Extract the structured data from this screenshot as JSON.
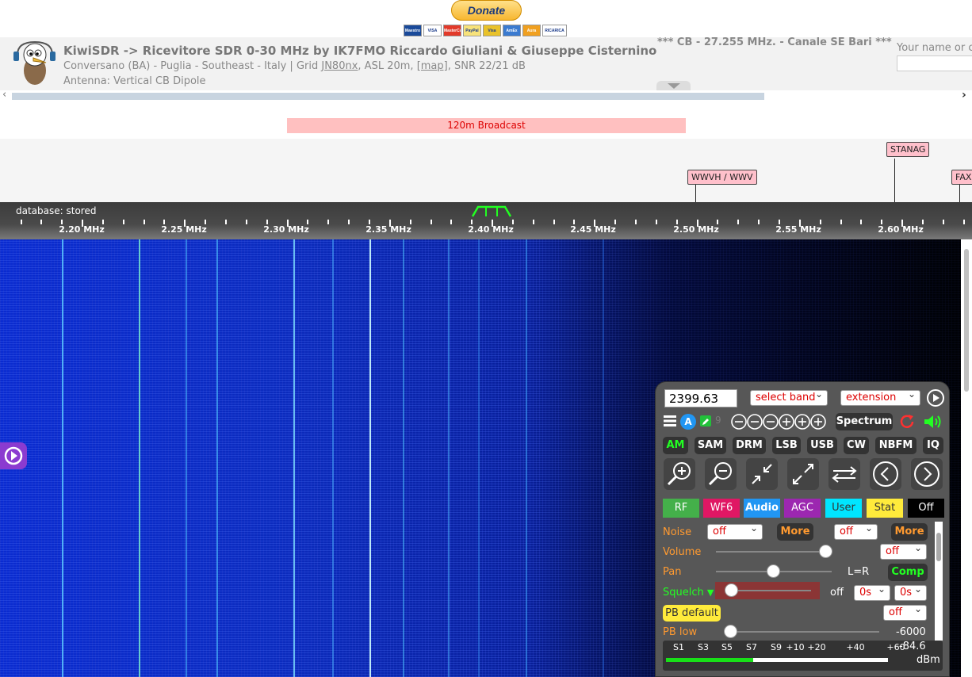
{
  "donate": {
    "label": "Donate",
    "cards": [
      "Maestro",
      "VISA",
      "MasterCard",
      "PayPal",
      "Visa Electron",
      "AmEx",
      "Aura",
      "RICARICA PAYPAL"
    ]
  },
  "header": {
    "title": "KiwiSDR -> Ricevitore SDR 0-30 MHz by IK7FMO Riccardo Giuliani & Giuseppe Cisternino",
    "location_prefix": "Conversano (BA) - Puglia - Southeast - Italy | Grid ",
    "grid": "JN80nx",
    "location_mid": ", ASL 20m, ",
    "map_link": "[map]",
    "location_suffix": ", SNR 22/21 dB",
    "antenna": "Antenna: Vertical CB Dipole",
    "motd": "*** CB - 27.255 MHz. - Canale SE Bari ***",
    "name_label": "Your name or c",
    "name_placeholder": ""
  },
  "scroll": {
    "left": "‹",
    "right": "›"
  },
  "band_bar": "120m Broadcast",
  "dx_labels": [
    "WWVH / WWV",
    "STANAG",
    "FAX"
  ],
  "scale": {
    "db_status": "database: stored",
    "freq_labels": [
      "2.20 MHz",
      "2.25 MHz",
      "2.30 MHz",
      "2.35 MHz",
      "2.40 MHz",
      "2.45 MHz",
      "2.50 MHz",
      "2.55 MHz",
      "2.60 MHz"
    ]
  },
  "panel": {
    "frequency": "2399.63",
    "select_band": "select band",
    "extension": "extension",
    "spectrum": "Spectrum",
    "badge_a": "A",
    "badge_9": "9",
    "modes": [
      "AM",
      "SAM",
      "DRM",
      "LSB",
      "USB",
      "CW",
      "NBFM",
      "IQ"
    ],
    "active_mode": "AM",
    "tabs": [
      "RF",
      "WF6",
      "Audio",
      "AGC",
      "User",
      "Stat",
      "Off"
    ],
    "noise_label": "Noise",
    "noise_a": "off",
    "noise_more_a": "More",
    "noise_b": "off",
    "noise_more_b": "More",
    "volume_label": "Volume",
    "volume_level": 0.95,
    "volume_sel": "off",
    "pan_label": "Pan",
    "pan_value": "L=R",
    "comp": "Comp",
    "squelch_label": "Squelch",
    "squelch_off": "off",
    "squelch_t1": "0s",
    "squelch_t2": "0s",
    "pb_default": "PB default",
    "pb_sel": "off",
    "pb_low_label": "PB low",
    "pb_low_value": "-6000",
    "smeter_labels": [
      "S1",
      "S3",
      "S5",
      "S7",
      "S9",
      "+10",
      "+20",
      "+40",
      "+60"
    ],
    "smeter_value": "-84.6",
    "smeter_unit": "dBm"
  },
  "colors": {
    "am": "#22ff22",
    "rf": "#44b04a",
    "wf": "#e01764",
    "audio": "#2196f3",
    "agc": "#9c27b0",
    "user": "#00e5ff",
    "stat": "#ffeb3b"
  }
}
